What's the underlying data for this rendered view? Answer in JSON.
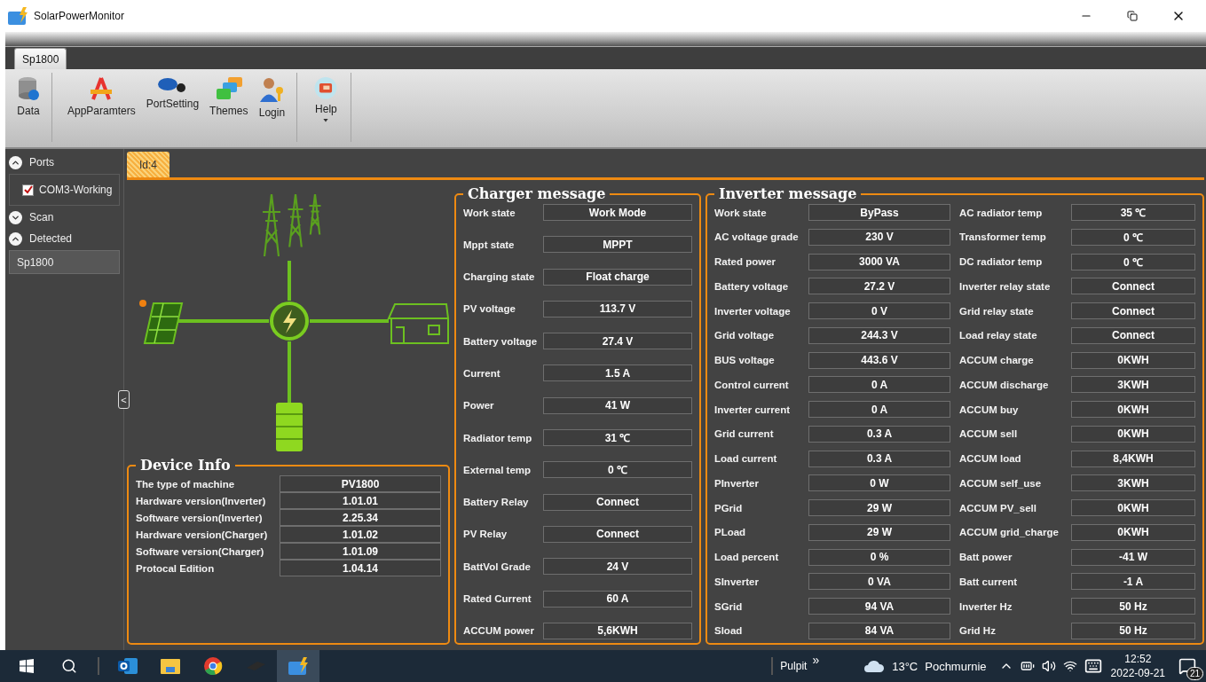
{
  "window": {
    "title": "SolarPowerMonitor"
  },
  "ribbon": {
    "tabs": [
      {
        "label": "Sp1800",
        "selected": true
      }
    ],
    "groups": [
      {
        "buttons": [
          {
            "label": "Data",
            "kind": "database",
            "dropdown": false
          }
        ]
      },
      {
        "buttons": [
          {
            "label": "AppParamters",
            "kind": "compass",
            "dropdown": false
          },
          {
            "label": "PortSetting",
            "kind": "plug",
            "dropdown": false
          },
          {
            "label": "Themes",
            "kind": "tiles",
            "dropdown": false
          },
          {
            "label": "Login",
            "kind": "user",
            "dropdown": false
          }
        ]
      },
      {
        "buttons": [
          {
            "label": "Help",
            "kind": "help",
            "dropdown": true
          }
        ]
      }
    ]
  },
  "sidebar": {
    "sections": [
      {
        "label": "Ports",
        "expanded": true,
        "items": [
          {
            "label": "COM3-Working",
            "kind": "checkbox",
            "checked": true
          }
        ]
      },
      {
        "label": "Scan",
        "expanded": false
      },
      {
        "label": "Detected",
        "expanded": true,
        "items": [
          {
            "label": "Sp1800",
            "kind": "device"
          }
        ]
      }
    ],
    "collapse_button": "<"
  },
  "content": {
    "tabs": [
      {
        "label": "Id:4",
        "selected": true
      }
    ],
    "device_info": {
      "title": "Device Info",
      "rows": [
        {
          "label": "The type of machine",
          "value": "PV1800"
        },
        {
          "label": "Hardware version(Inverter)",
          "value": "1.01.01"
        },
        {
          "label": "Software version(Inverter)",
          "value": "2.25.34"
        },
        {
          "label": "Hardware version(Charger)",
          "value": "1.01.02"
        },
        {
          "label": "Software version(Charger)",
          "value": "1.01.09"
        },
        {
          "label": "Protocal Edition",
          "value": "1.04.14"
        }
      ]
    },
    "charger": {
      "title": "Charger message",
      "rows": [
        {
          "label": "Work state",
          "value": "Work Mode"
        },
        {
          "label": "Mppt state",
          "value": "MPPT"
        },
        {
          "label": "Charging state",
          "value": "Float charge"
        },
        {
          "label": "PV voltage",
          "value": "113.7 V"
        },
        {
          "label": "Battery voltage",
          "value": "27.4 V"
        },
        {
          "label": "Current",
          "value": "1.5 A"
        },
        {
          "label": "Power",
          "value": "41 W"
        },
        {
          "label": "Radiator temp",
          "value": "31 ℃"
        },
        {
          "label": "External temp",
          "value": "0 ℃"
        },
        {
          "label": "Battery Relay",
          "value": "Connect"
        },
        {
          "label": "PV Relay",
          "value": "Connect"
        },
        {
          "label": "BattVol Grade",
          "value": "24 V"
        },
        {
          "label": "Rated Current",
          "value": "60 A"
        },
        {
          "label": "ACCUM power",
          "value": "5,6KWH"
        }
      ]
    },
    "inverter": {
      "title": "Inverter message",
      "columns": [
        {
          "rows": [
            {
              "label": "Work state",
              "value": "ByPass"
            },
            {
              "label": "AC voltage grade",
              "value": "230 V"
            },
            {
              "label": "Rated power",
              "value": "3000 VA"
            },
            {
              "label": "Battery voltage",
              "value": "27.2 V"
            },
            {
              "label": "Inverter voltage",
              "value": "0 V"
            },
            {
              "label": "Grid voltage",
              "value": "244.3 V"
            },
            {
              "label": "BUS voltage",
              "value": "443.6 V"
            },
            {
              "label": "Control current",
              "value": "0 A"
            },
            {
              "label": "Inverter current",
              "value": "0 A"
            },
            {
              "label": "Grid current",
              "value": "0.3 A"
            },
            {
              "label": "Load current",
              "value": "0.3 A"
            },
            {
              "label": "PInverter",
              "value": "0 W"
            },
            {
              "label": "PGrid",
              "value": "29 W"
            },
            {
              "label": "PLoad",
              "value": "29 W"
            },
            {
              "label": "Load percent",
              "value": "0 %"
            },
            {
              "label": "SInverter",
              "value": "0 VA"
            },
            {
              "label": "SGrid",
              "value": "94 VA"
            },
            {
              "label": "Sload",
              "value": "84 VA"
            }
          ]
        },
        {
          "rows": [
            {
              "label": "AC radiator temp",
              "value": "35 ℃"
            },
            {
              "label": "Transformer temp",
              "value": "0 ℃"
            },
            {
              "label": "DC radiator temp",
              "value": "0 ℃"
            },
            {
              "label": "Inverter relay state",
              "value": "Connect"
            },
            {
              "label": "Grid relay state",
              "value": "Connect"
            },
            {
              "label": "Load relay state",
              "value": "Connect"
            },
            {
              "label": "ACCUM charge",
              "value": "0KWH"
            },
            {
              "label": "ACCUM discharge",
              "value": "3KWH"
            },
            {
              "label": "ACCUM buy",
              "value": "0KWH"
            },
            {
              "label": "ACCUM sell",
              "value": "0KWH"
            },
            {
              "label": "ACCUM load",
              "value": "8,4KWH"
            },
            {
              "label": "ACCUM self_use",
              "value": "3KWH"
            },
            {
              "label": "ACCUM PV_sell",
              "value": "0KWH"
            },
            {
              "label": "ACCUM grid_charge",
              "value": "0KWH"
            },
            {
              "label": "Batt power",
              "value": "-41 W"
            },
            {
              "label": "Batt current",
              "value": "-1 A"
            },
            {
              "label": "Inverter Hz",
              "value": "50 Hz"
            },
            {
              "label": "Grid Hz",
              "value": "50 Hz"
            }
          ]
        }
      ]
    }
  },
  "taskbar": {
    "apps": [
      {
        "kind": "mail",
        "selected": false
      },
      {
        "kind": "folder",
        "selected": false
      },
      {
        "kind": "browser",
        "selected": false
      },
      {
        "kind": "device",
        "selected": false
      },
      {
        "kind": "solar",
        "selected": true
      }
    ],
    "toolbar_label": "Pulpit",
    "toolbar_more": "»",
    "weather": {
      "temperature": "13°C",
      "condition": "Pochmurnie"
    },
    "clock": {
      "time": "12:52",
      "date": "2022-09-21"
    },
    "notifications": "21"
  }
}
